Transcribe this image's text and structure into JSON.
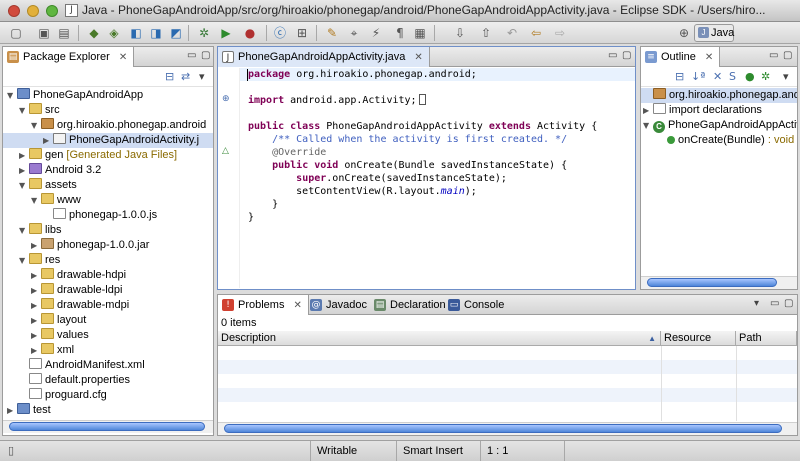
{
  "window": {
    "title": "Java - PhoneGapAndroidApp/src/org/hiroakio/phonegap/android/PhoneGapAndroidAppActivity.java - Eclipse SDK - /Users/hiro..."
  },
  "toolbar": {
    "perspective_label": "Java"
  },
  "package_explorer": {
    "tab_label": "Package Explorer",
    "tree": [
      {
        "label": "PhoneGapAndroidApp",
        "icon": "project-icon",
        "level": 0,
        "expanded": true
      },
      {
        "label": "src",
        "icon": "folder-icon",
        "level": 1,
        "expanded": true
      },
      {
        "label": "org.hiroakio.phonegap.android",
        "icon": "package-icon",
        "level": 2,
        "expanded": true
      },
      {
        "label": "PhoneGapAndroidActivity.j",
        "icon": "java-file-icon",
        "level": 3,
        "expanded": false,
        "selected": true
      },
      {
        "label": "gen",
        "decoration": "[Generated Java Files]",
        "icon": "folder-icon",
        "level": 1,
        "expanded": false
      },
      {
        "label": "Android 3.2",
        "icon": "library-icon",
        "level": 1,
        "expanded": false
      },
      {
        "label": "assets",
        "icon": "folder-icon",
        "level": 1,
        "expanded": true
      },
      {
        "label": "www",
        "icon": "folder-icon",
        "level": 2,
        "expanded": true
      },
      {
        "label": "phonegap-1.0.0.js",
        "icon": "file-icon",
        "level": 3,
        "expanded": false
      },
      {
        "label": "libs",
        "icon": "folder-icon",
        "level": 1,
        "expanded": true
      },
      {
        "label": "phonegap-1.0.0.jar",
        "icon": "jar-icon",
        "level": 2,
        "expanded": false
      },
      {
        "label": "res",
        "icon": "folder-icon",
        "level": 1,
        "expanded": true
      },
      {
        "label": "drawable-hdpi",
        "icon": "folder-icon",
        "level": 2,
        "expanded": false
      },
      {
        "label": "drawable-ldpi",
        "icon": "folder-icon",
        "level": 2,
        "expanded": false
      },
      {
        "label": "drawable-mdpi",
        "icon": "folder-icon",
        "level": 2,
        "expanded": false
      },
      {
        "label": "layout",
        "icon": "folder-icon",
        "level": 2,
        "expanded": false
      },
      {
        "label": "values",
        "icon": "folder-icon",
        "level": 2,
        "expanded": false
      },
      {
        "label": "xml",
        "icon": "folder-icon",
        "level": 2,
        "expanded": false
      },
      {
        "label": "AndroidManifest.xml",
        "icon": "file-icon",
        "level": 1,
        "expanded": false
      },
      {
        "label": "default.properties",
        "icon": "file-icon",
        "level": 1,
        "expanded": false
      },
      {
        "label": "proguard.cfg",
        "icon": "file-icon",
        "level": 1,
        "expanded": false
      },
      {
        "label": "test",
        "icon": "project-icon",
        "level": 0,
        "expanded": false
      }
    ]
  },
  "editor": {
    "tab_label": "PhoneGapAndroidAppActivity.java",
    "lines": [
      "package org.hiroakio.phonegap.android;",
      "",
      "import android.app.Activity;",
      "",
      "public class PhoneGapAndroidAppActivity extends Activity {",
      "    /** Called when the activity is first created. */",
      "    @Override",
      "    public void onCreate(Bundle savedInstanceState) {",
      "        super.onCreate(savedInstanceState);",
      "        setContentView(R.layout.main);",
      "    }",
      "}"
    ]
  },
  "outline": {
    "tab_label": "Outline",
    "items": [
      {
        "label": "org.hiroakio.phonegap.andro",
        "icon": "package-icon",
        "level": 0,
        "selected": true
      },
      {
        "label": "import declarations",
        "icon": "imports-icon",
        "level": 0
      },
      {
        "label": "PhoneGapAndroidAppActivi",
        "icon": "class-icon",
        "level": 0
      },
      {
        "label": "onCreate(Bundle)",
        "suffix": " : void",
        "icon": "method-icon",
        "level": 1
      }
    ]
  },
  "bottom_panel": {
    "tabs": [
      {
        "label": "Problems",
        "active": true
      },
      {
        "label": "Javadoc"
      },
      {
        "label": "Declaration"
      },
      {
        "label": "Console"
      }
    ],
    "count": "0 items",
    "columns": [
      "Description",
      "Resource",
      "Path"
    ]
  },
  "status_bar": {
    "mode": "Writable",
    "insert_mode": "Smart Insert",
    "position": "1 : 1"
  }
}
